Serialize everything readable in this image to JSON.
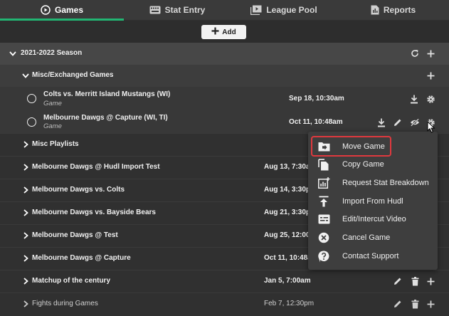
{
  "tabs": [
    {
      "label": "Games",
      "icon": "play-circle-icon",
      "active": true
    },
    {
      "label": "Stat Entry",
      "icon": "keyboard-icon",
      "active": false
    },
    {
      "label": "League Pool",
      "icon": "video-library-icon",
      "active": false
    },
    {
      "label": "Reports",
      "icon": "report-icon",
      "active": false
    }
  ],
  "add_button": {
    "label": "Add"
  },
  "season": {
    "label": "2021-2022 Season"
  },
  "subgroup": {
    "label": "Misc/Exchanged Games"
  },
  "games": [
    {
      "title": "Colts vs. Merritt Island Mustangs (WI)",
      "type": "Game",
      "date": "Sep 18, 10:30am"
    },
    {
      "title": "Melbourne Dawgs @ Capture (WI, TI)",
      "type": "Game",
      "date": "Oct 11, 10:48am"
    }
  ],
  "list_rows": [
    {
      "label": "Misc Playlists",
      "date": ""
    },
    {
      "label": "Melbourne Dawgs @ Hudl Import Test",
      "date": "Aug 13, 7:30a"
    },
    {
      "label": "Melbourne Dawgs vs. Colts",
      "date": "Aug 14, 3:30p"
    },
    {
      "label": "Melbourne Dawgs vs. Bayside Bears",
      "date": "Aug 21, 3:30p"
    },
    {
      "label": "Melbourne Dawgs @ Test",
      "date": "Aug 25, 12:00p"
    },
    {
      "label": "Melbourne Dawgs @ Capture",
      "date": "Oct 11, 10:48a"
    },
    {
      "label": "Matchup of the century",
      "date": "Jan 5, 7:00am"
    },
    {
      "label": "Fights during Games",
      "date": "Feb 7, 12:30pm"
    }
  ],
  "context_menu": [
    {
      "label": "Move Game",
      "icon": "folder-move-icon"
    },
    {
      "label": "Copy Game",
      "icon": "copy-icon"
    },
    {
      "label": "Request Stat Breakdown",
      "icon": "stat-breakdown-icon"
    },
    {
      "label": "Import From Hudl",
      "icon": "import-icon"
    },
    {
      "label": "Edit/Intercut Video",
      "icon": "subtitles-icon"
    },
    {
      "label": "Cancel Game",
      "icon": "cancel-icon"
    },
    {
      "label": "Contact Support",
      "icon": "support-icon"
    }
  ],
  "colors": {
    "accent": "#22b573",
    "highlight": "#e0393e"
  }
}
